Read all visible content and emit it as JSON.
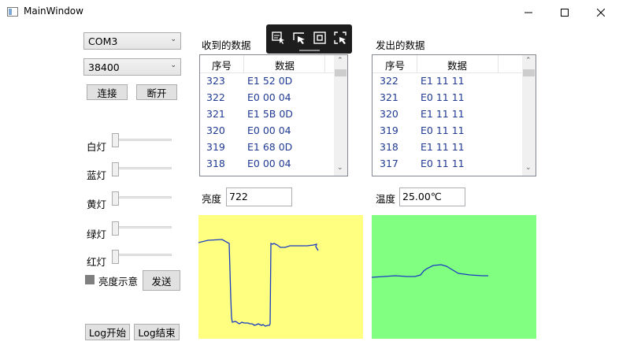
{
  "window": {
    "title": "MainWindow"
  },
  "serial": {
    "port": "COM3",
    "baud": "38400",
    "connect_label": "连接",
    "disconnect_label": "断开"
  },
  "sliders": [
    {
      "label": "白灯",
      "value": 0
    },
    {
      "label": "蓝灯",
      "value": 0
    },
    {
      "label": "黄灯",
      "value": 0
    },
    {
      "label": "绿灯",
      "value": 0
    },
    {
      "label": "红灯",
      "value": 0
    }
  ],
  "brightness_hint": {
    "label": "亮度示意",
    "color": "#7f7f7f"
  },
  "send_label": "发送",
  "log": {
    "start_label": "Log开始",
    "stop_label": "Log结束"
  },
  "received": {
    "title": "收到的数据",
    "columns": [
      "序号",
      "数据"
    ],
    "rows": [
      [
        "323",
        "E1 52 0D"
      ],
      [
        "322",
        "E0 00 04"
      ],
      [
        "321",
        "E1 5B 0D"
      ],
      [
        "320",
        "E0 00 04"
      ],
      [
        "319",
        "E1 68 0D"
      ],
      [
        "318",
        "E0 00 04"
      ]
    ]
  },
  "sent": {
    "title": "发出的数据",
    "columns": [
      "序号",
      "数据"
    ],
    "rows": [
      [
        "322",
        "E1 11 11"
      ],
      [
        "321",
        "E0 11 11"
      ],
      [
        "320",
        "E1 11 11"
      ],
      [
        "319",
        "E0 11 11"
      ],
      [
        "318",
        "E1 11 11"
      ],
      [
        "317",
        "E0 11 11"
      ]
    ]
  },
  "brightness": {
    "label": "亮度",
    "value": "722"
  },
  "temperature": {
    "label": "温度",
    "value": "25.00℃"
  },
  "colors": {
    "brightness_plot_bg": "#ffff80",
    "temperature_plot_bg": "#80ff80",
    "trace": "#1a3cc4"
  },
  "toolbar_icons": [
    "select-element-icon",
    "pointer-icon",
    "frame-icon",
    "track-focus-icon"
  ]
}
